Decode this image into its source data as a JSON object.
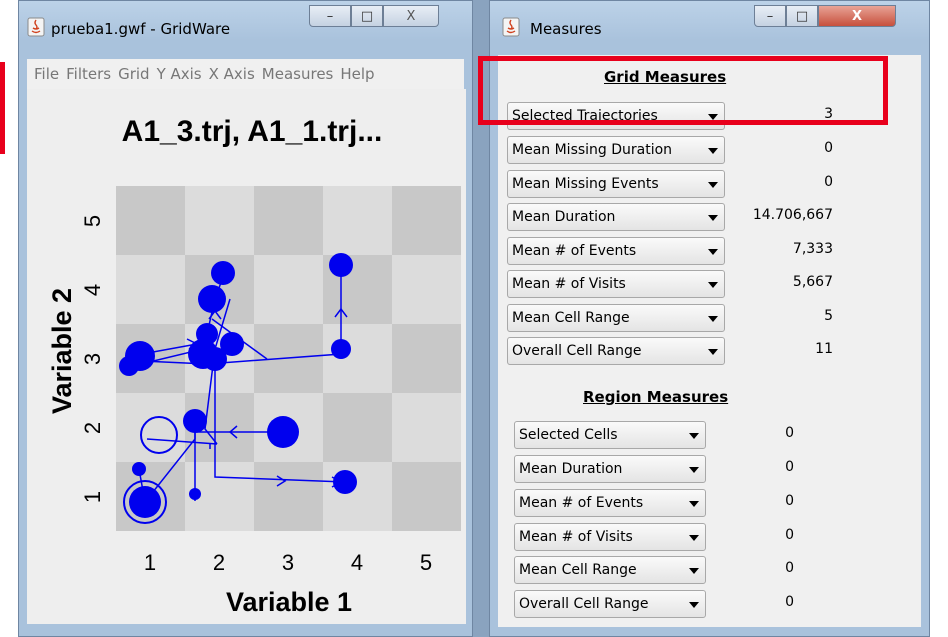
{
  "grid_window": {
    "title": "prueba1.gwf - GridWare",
    "menu": [
      "File",
      "Filters",
      "Grid",
      "Y Axis",
      "X Axis",
      "Measures",
      "Help"
    ],
    "plot_title": "A1_3.trj, A1_1.trj...",
    "x_label": "Variable 1",
    "y_label": "Variable 2",
    "x_ticks": [
      "1",
      "2",
      "3",
      "4",
      "5"
    ],
    "y_ticks": [
      "1",
      "2",
      "3",
      "4",
      "5"
    ],
    "marker_color": "#0000ee"
  },
  "measures_window": {
    "title": "Measures",
    "grid_section_title": "Grid Measures",
    "grid_measures": [
      {
        "label": "Selected Trajectories",
        "value": "3"
      },
      {
        "label": "Mean Missing Duration",
        "value": "0"
      },
      {
        "label": "Mean Missing Events",
        "value": "0"
      },
      {
        "label": "Mean Duration",
        "value": "14.706,667"
      },
      {
        "label": "Mean # of Events",
        "value": "7,333"
      },
      {
        "label": "Mean # of Visits",
        "value": "5,667"
      },
      {
        "label": "Mean Cell Range",
        "value": "5"
      },
      {
        "label": "Overall Cell Range",
        "value": "11"
      }
    ],
    "region_section_title": "Region Measures",
    "region_measures": [
      {
        "label": "Selected Cells",
        "value": "0"
      },
      {
        "label": "Mean Duration",
        "value": "0"
      },
      {
        "label": "Mean # of Events",
        "value": "0"
      },
      {
        "label": "Mean # of Visits",
        "value": "0"
      },
      {
        "label": "Mean Cell Range",
        "value": "0"
      },
      {
        "label": "Overall Cell Range",
        "value": "0"
      }
    ]
  },
  "window_buttons": {
    "minimize": "–",
    "maximize": "□",
    "close": "X"
  },
  "colors": {
    "highlight": "#e8001c",
    "titlebar": "#a9c2dc"
  }
}
